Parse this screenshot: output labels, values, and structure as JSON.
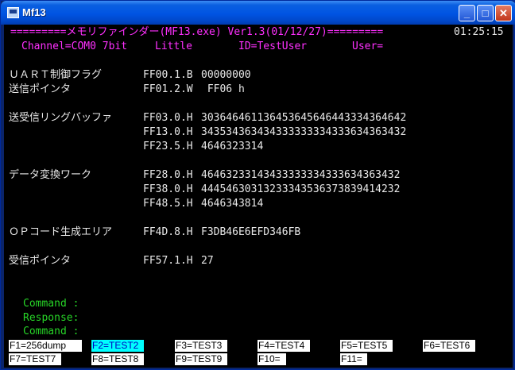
{
  "window": {
    "title": "Mf13",
    "buttons": {
      "minimize": "_",
      "maximize": "□",
      "close": "✕"
    },
    "icon": "app-icon"
  },
  "header": {
    "banner": "=========メモリファインダー(MF13.exe) Ver1.3(01/12/27)=========",
    "clock": "01:25:15",
    "channel": "Channel=COM0 7bit",
    "endian": "Little",
    "id": "ID=TestUser",
    "user": "User="
  },
  "entries": [
    {
      "label": "ＵＡＲＴ制御フラグ",
      "lines": [
        {
          "addr": "FF00.1.B",
          "value": "00000000"
        }
      ]
    },
    {
      "label": "送信ポインタ",
      "lines": [
        {
          "addr": "FF01.2.W",
          "value": " FF06 h"
        }
      ]
    },
    {
      "label": "送受信リングバッファ",
      "lines": [
        {
          "addr": "FF03.0.H",
          "value": "30364646113645364564644333436464​2"
        },
        {
          "addr": "FF13.0.H",
          "value": "3435343634343333333343336343634​32"
        },
        {
          "addr": "FF23.5.H",
          "value": "4646323314"
        }
      ]
    },
    {
      "label": "データ変換ワーク",
      "lines": [
        {
          "addr": "FF28.0.H",
          "value": "4646323314343333333433363436343​2"
        },
        {
          "addr": "FF38.0.H",
          "value": "4445463031323334353637383941423​2"
        },
        {
          "addr": "FF48.5.H",
          "value": "4646343814"
        }
      ]
    },
    {
      "label": "ＯＰコード生成エリア",
      "lines": [
        {
          "addr": "FF4D.8.H",
          "value": "F3DB46E6EFD346FB"
        }
      ]
    },
    {
      "label": "受信ポインタ",
      "lines": [
        {
          "addr": "FF57.1.H",
          "value": "27"
        }
      ]
    }
  ],
  "prompts": {
    "command1": "Command :",
    "response": "Response:",
    "command2": "Command :"
  },
  "fkeys": {
    "f1": "F1=256dump",
    "f2": "F2=TEST2",
    "f3": "F3=TEST3",
    "f4": "F4=TEST4",
    "f5": "F5=TEST5",
    "f6": "F6=TEST6",
    "f7": "F7=TEST7",
    "f8": "F8=TEST8",
    "f9": "F9=TEST9",
    "f10": "F10=",
    "f11": "F11="
  },
  "colors": {
    "background": "#000000",
    "banner": "#ff30ff",
    "text": "#e8e8e8",
    "prompt": "#27d527",
    "fkey_selected": "#00ffff"
  }
}
